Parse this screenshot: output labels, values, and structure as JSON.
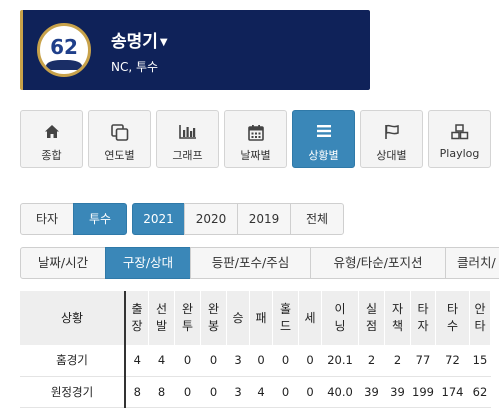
{
  "player": {
    "number": "62",
    "name": "송명기",
    "team_position": "NC, 투수"
  },
  "nav": [
    {
      "label": "종합",
      "icon": "home-icon"
    },
    {
      "label": "연도별",
      "icon": "copy-icon"
    },
    {
      "label": "그래프",
      "icon": "bar-chart-icon"
    },
    {
      "label": "날짜별",
      "icon": "calendar-icon"
    },
    {
      "label": "상황별",
      "icon": "menu-icon",
      "active": true
    },
    {
      "label": "상대별",
      "icon": "flag-icon"
    },
    {
      "label": "Playlog",
      "icon": "cubes-icon"
    }
  ],
  "role_tabs": [
    {
      "label": "타자"
    },
    {
      "label": "투수",
      "active": true
    }
  ],
  "year_tabs": [
    {
      "label": "2021",
      "active": true
    },
    {
      "label": "2020"
    },
    {
      "label": "2019"
    },
    {
      "label": "전체"
    }
  ],
  "category_tabs": [
    {
      "label": "날짜/시간"
    },
    {
      "label": "구장/상대",
      "active": true
    },
    {
      "label": "등판/포수/주심"
    },
    {
      "label": "유형/타순/포지션"
    },
    {
      "label": "클러치/"
    }
  ],
  "table": {
    "headers": [
      "상황",
      "출\n장",
      "선\n발",
      "완\n투",
      "완\n봉",
      "승",
      "패",
      "홀\n드",
      "세",
      "이\n닝",
      "실\n점",
      "자\n책",
      "타\n자",
      "타\n수",
      "안\n타"
    ],
    "rows": [
      [
        "홈경기",
        "4",
        "4",
        "0",
        "0",
        "3",
        "0",
        "0",
        "0",
        "20.1",
        "2",
        "2",
        "77",
        "72",
        "15"
      ],
      [
        "원정경기",
        "8",
        "8",
        "0",
        "0",
        "3",
        "4",
        "0",
        "0",
        "40.0",
        "39",
        "39",
        "199",
        "174",
        "62"
      ]
    ]
  },
  "colors": {
    "header_bg": "#0f2259",
    "accent_gold": "#c8a24a",
    "active_blue": "#3a87b8"
  }
}
